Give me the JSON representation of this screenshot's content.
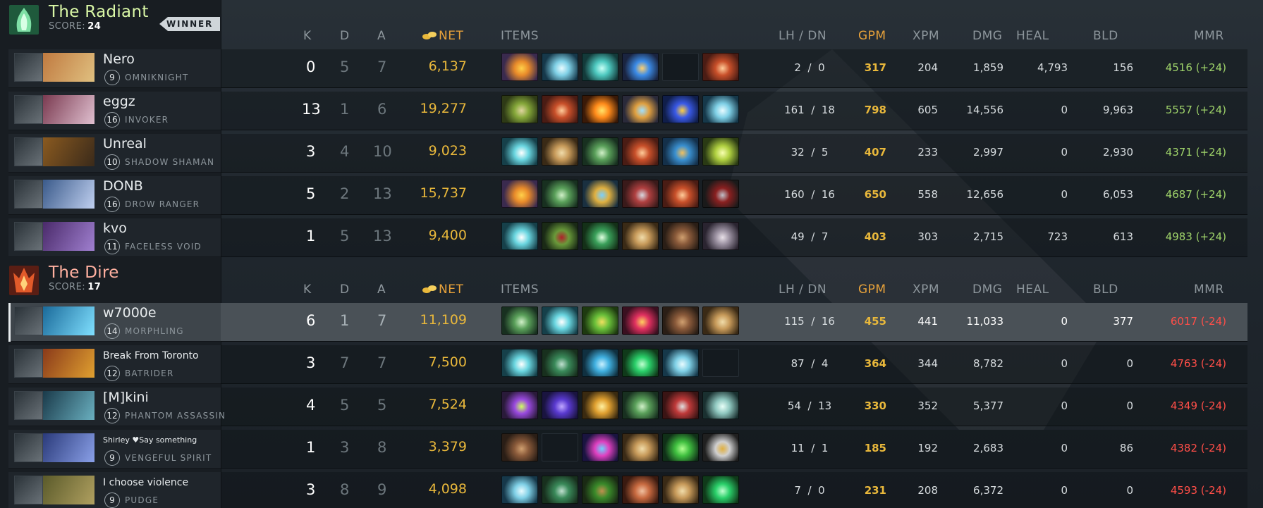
{
  "columns": {
    "k": "K",
    "d": "D",
    "a": "A",
    "net": "NET",
    "items": "ITEMS",
    "lhdn": "LH / DN",
    "gpm": "GPM",
    "xpm": "XPM",
    "dmg": "DMG",
    "heal": "HEAL",
    "bld": "BLD",
    "mmr": "MMR"
  },
  "radiant": {
    "name": "The Radiant",
    "score_label": "SCORE:",
    "score": "24",
    "badge": "WINNER",
    "name_color": "#d9f7a6",
    "players": [
      {
        "name": "Nero",
        "level": "9",
        "hero": "OMNIKNIGHT",
        "k": "0",
        "d": "5",
        "a": "7",
        "net": "6,137",
        "lh": "2",
        "dn": "0",
        "gpm": "317",
        "xpm": "204",
        "dmg": "1,859",
        "heal": "4,793",
        "bld": "156",
        "mmr": "4516 (+24)",
        "items": [
          "item-orange",
          "item-wave",
          "item-teal-drop",
          "item-blue-orb",
          "empty",
          "item-red-cloak"
        ]
      },
      {
        "name": "eggz",
        "level": "16",
        "hero": "INVOKER",
        "k": "13",
        "d": "1",
        "a": "6",
        "net": "19,277",
        "lh": "161",
        "dn": "18",
        "gpm": "798",
        "xpm": "605",
        "dmg": "14,556",
        "heal": "0",
        "bld": "9,963",
        "mmr": "5557 (+24)",
        "items": [
          "item-green-bowl",
          "item-red-cloak",
          "item-fire",
          "item-staff",
          "item-blue-staff",
          "item-wave"
        ]
      },
      {
        "name": "Unreal",
        "level": "10",
        "hero": "SHADOW SHAMAN",
        "k": "3",
        "d": "4",
        "a": "10",
        "net": "9,023",
        "lh": "32",
        "dn": "5",
        "gpm": "407",
        "xpm": "233",
        "dmg": "2,997",
        "heal": "0",
        "bld": "2,930",
        "mmr": "4371 (+24)",
        "items": [
          "item-blade",
          "item-scroll",
          "item-dagger",
          "item-red-cloak",
          "item-blue-globe",
          "item-trident"
        ]
      },
      {
        "name": "DONB",
        "level": "16",
        "hero": "DROW RANGER",
        "k": "5",
        "d": "2",
        "a": "13",
        "net": "15,737",
        "lh": "160",
        "dn": "16",
        "gpm": "650",
        "xpm": "558",
        "dmg": "12,656",
        "heal": "0",
        "bld": "6,053",
        "mmr": "4687 (+24)",
        "items": [
          "item-orange",
          "item-dagger",
          "item-ring",
          "item-claw",
          "item-red-cloak",
          "item-mask"
        ]
      },
      {
        "name": "kvo",
        "level": "11",
        "hero": "FACELESS VOID",
        "k": "1",
        "d": "5",
        "a": "13",
        "net": "9,400",
        "lh": "49",
        "dn": "7",
        "gpm": "403",
        "xpm": "303",
        "dmg": "2,715",
        "heal": "723",
        "bld": "613",
        "mmr": "4983 (+24)",
        "items": [
          "item-blade",
          "item-green-mask",
          "item-green-blade",
          "item-scroll",
          "item-boots",
          "item-sphere"
        ]
      }
    ]
  },
  "dire": {
    "name": "The Dire",
    "score_label": "SCORE:",
    "score": "17",
    "name_color": "#ffb0a0",
    "players": [
      {
        "name": "w7000e",
        "level": "14",
        "hero": "MORPHLING",
        "k": "6",
        "d": "1",
        "a": "7",
        "net": "11,109",
        "lh": "115",
        "dn": "16",
        "gpm": "455",
        "xpm": "441",
        "dmg": "11,033",
        "heal": "0",
        "bld": "377",
        "mmr": "6017 (-24)",
        "items": [
          "item-dagger",
          "item-blade",
          "item-green-sword",
          "item-red-orb",
          "item-boots",
          "item-scroll"
        ]
      },
      {
        "name": "Break From Toronto",
        "level": "12",
        "hero": "BATRIDER",
        "k": "3",
        "d": "7",
        "a": "7",
        "net": "7,500",
        "lh": "87",
        "dn": "4",
        "gpm": "364",
        "xpm": "344",
        "dmg": "8,782",
        "heal": "0",
        "bld": "0",
        "mmr": "4763 (-24)",
        "items": [
          "item-blade",
          "item-axe-green",
          "item-crystal",
          "item-green-boot",
          "item-wave",
          "empty"
        ]
      },
      {
        "name": "[M]kini",
        "level": "12",
        "hero": "PHANTOM ASSASSIN",
        "k": "4",
        "d": "5",
        "a": "5",
        "net": "7,524",
        "lh": "54",
        "dn": "13",
        "gpm": "330",
        "xpm": "352",
        "dmg": "5,377",
        "heal": "0",
        "bld": "0",
        "mmr": "4349 (-24)",
        "items": [
          "item-purple-orb",
          "item-purple-hat",
          "item-gold",
          "item-dagger",
          "item-battleaxe",
          "item-mushroom"
        ]
      },
      {
        "name": "Shirley ♥Say something",
        "level": "9",
        "hero": "VENGEFUL SPIRIT",
        "k": "1",
        "d": "3",
        "a": "8",
        "net": "3,379",
        "lh": "11",
        "dn": "1",
        "gpm": "185",
        "xpm": "192",
        "dmg": "2,683",
        "heal": "0",
        "bld": "86",
        "mmr": "4382 (-24)",
        "items": [
          "item-boots",
          "empty",
          "item-pink-ring",
          "item-scroll",
          "item-green-leaf",
          "item-hook"
        ]
      },
      {
        "name": "I choose violence",
        "level": "9",
        "hero": "PUDGE",
        "k": "3",
        "d": "8",
        "a": "9",
        "net": "4,098",
        "lh": "7",
        "dn": "0",
        "gpm": "231",
        "xpm": "208",
        "dmg": "6,372",
        "heal": "0",
        "bld": "0",
        "mmr": "4593 (-24)",
        "items": [
          "item-wave",
          "item-axe-green",
          "item-branch",
          "item-ball",
          "item-scroll",
          "item-green-boot"
        ]
      }
    ]
  },
  "colors": {
    "gold": "#e9b83b",
    "mmr_up": "#9fd36a",
    "mmr_down": "#ff4e48"
  }
}
